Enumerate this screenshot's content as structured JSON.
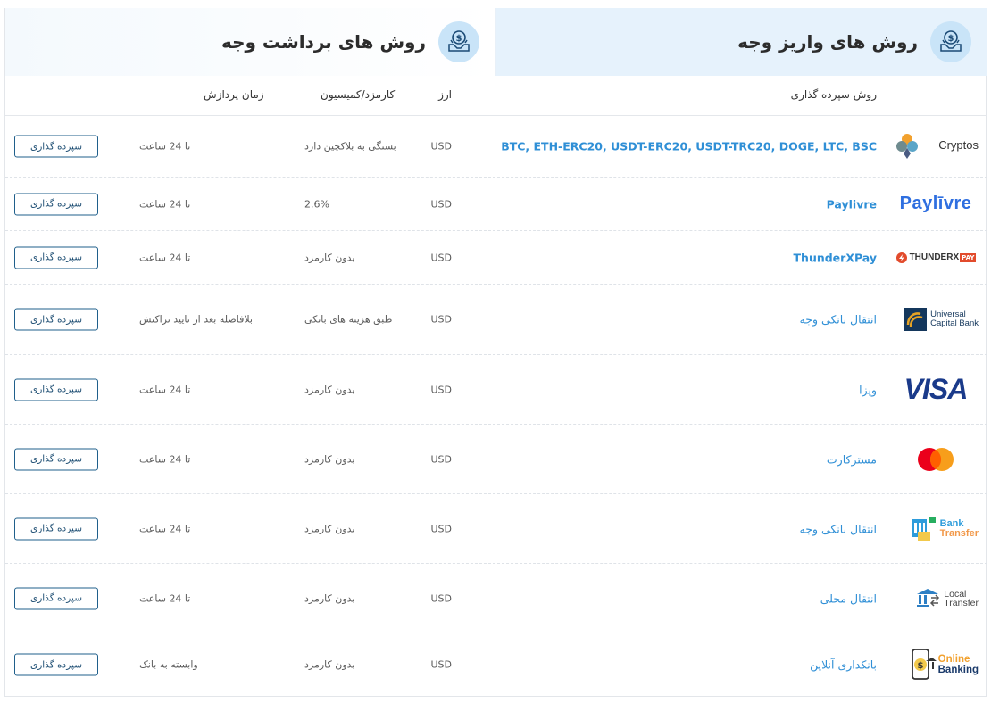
{
  "tabs": {
    "deposit_title": "روش های واریز وجه",
    "withdraw_title": "روش های برداشت وجه"
  },
  "columns": {
    "method": "روش سپرده گذاری",
    "currency": "ارز",
    "fee": "کارمزد/کمیسیون",
    "time": "زمان پردازش"
  },
  "rows": [
    {
      "logo": "cryptos-logo",
      "logo_text": "Cryptos",
      "method": "BTC, ETH-ERC20, USDT-ERC20, USDT-TRC20, DOGE, LTC, BSC",
      "currency": "USD",
      "fee": "بستگی به بلاکچین دارد",
      "time": "تا 24 ساعت",
      "button": "سپرده گذاری"
    },
    {
      "logo": "paylivre-logo",
      "logo_text": "Paylīvre",
      "method": "Paylivre",
      "currency": "USD",
      "fee": "2.6%",
      "time": "تا 24 ساعت",
      "button": "سپرده گذاری"
    },
    {
      "logo": "thunderxpay-logo",
      "logo_text": "THUNDERX",
      "logo_badge": "PAY",
      "method": "ThunderXPay",
      "currency": "USD",
      "fee": "بدون کارمزد",
      "time": "تا 24 ساعت",
      "button": "سپرده گذاری"
    },
    {
      "logo": "universal-capital-bank-logo",
      "logo_text": "Universal",
      "logo_text2": "Capital Bank",
      "method": "انتقال بانکی وجه",
      "currency": "USD",
      "fee": "طبق هزینه های بانکی",
      "time": "بلافاصله بعد از تایید تراکنش",
      "button": "سپرده گذاری"
    },
    {
      "logo": "visa-logo",
      "logo_text": "VISA",
      "method": "ویزا",
      "currency": "USD",
      "fee": "بدون کارمزد",
      "time": "تا 24 ساعت",
      "button": "سپرده گذاری"
    },
    {
      "logo": "mastercard-logo",
      "method": "مسترکارت",
      "currency": "USD",
      "fee": "بدون کارمزد",
      "time": "تا 24 ساعت",
      "button": "سپرده گذاری"
    },
    {
      "logo": "bank-transfer-logo",
      "logo_text": "Bank",
      "logo_text2": "Transfer",
      "method": "انتقال بانکی وجه",
      "currency": "USD",
      "fee": "بدون کارمزد",
      "time": "تا 24 ساعت",
      "button": "سپرده گذاری"
    },
    {
      "logo": "local-transfer-logo",
      "logo_text": "Local",
      "logo_text2": "Transfer",
      "method": "انتقال محلی",
      "currency": "USD",
      "fee": "بدون کارمزد",
      "time": "تا 24 ساعت",
      "button": "سپرده گذاری"
    },
    {
      "logo": "online-banking-logo",
      "logo_text": "Online",
      "logo_text2": "Banking",
      "method": "بانکداری آنلاین",
      "currency": "USD",
      "fee": "بدون کارمزد",
      "time": "وابسته به بانک",
      "button": "سپرده گذاری"
    }
  ],
  "colors": {
    "accent": "#2f8fd6",
    "button_border": "#1f5f8b",
    "tab_active_bg": "#e6f2fc",
    "icon_circle": "#c9e4f8"
  }
}
